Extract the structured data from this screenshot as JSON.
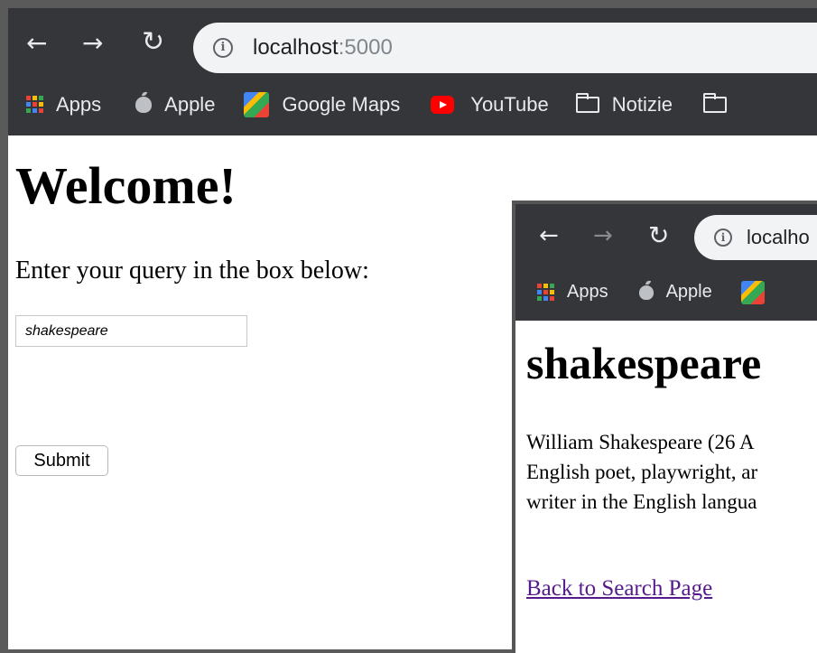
{
  "window_main": {
    "address": {
      "host": "localhost",
      "port": ":5000"
    },
    "bookmarks": [
      "Apps",
      "Apple",
      "Google Maps",
      "YouTube",
      "Notizie"
    ],
    "heading": "Welcome!",
    "prompt": "Enter your query in the box below:",
    "query_value": "shakespeare",
    "submit_label": "Submit"
  },
  "window_result": {
    "address": {
      "host": "localho"
    },
    "bookmarks": [
      "Apps",
      "Apple"
    ],
    "heading": "shakespeare",
    "summary_lines": [
      "William Shakespeare (26 A",
      "English poet, playwright, ar",
      "writer in the English langua"
    ],
    "back_link": "Back to Search Page"
  },
  "colors": {
    "toolbar": "#35363a",
    "omnibox": "#f1f3f4",
    "link": "#551a8b"
  },
  "icons": [
    "back-arrow-icon",
    "forward-arrow-icon",
    "reload-icon",
    "info-icon",
    "apps-grid-icon",
    "apple-icon",
    "google-maps-icon",
    "youtube-icon",
    "folder-icon"
  ]
}
